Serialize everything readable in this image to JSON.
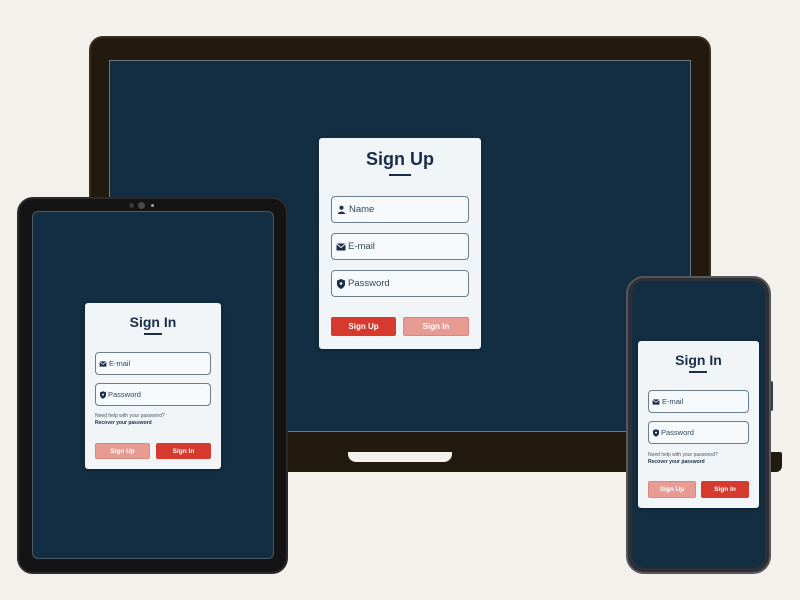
{
  "colors": {
    "page_bg": "#f4f1ec",
    "screen_bg": "#132e42",
    "card_bg": "#f1f5f8",
    "title": "#1b2d4a",
    "primary_red": "#d63a2f",
    "faded_red": "#e89b93",
    "laptop_frame": "#221a0f",
    "tablet_frame": "#141414",
    "phone_frame": "#2e3035"
  },
  "laptop": {
    "title": "Sign Up",
    "fields": {
      "name": {
        "placeholder": "Name",
        "icon": "user-icon"
      },
      "email": {
        "placeholder": "E-mail",
        "icon": "mail-icon"
      },
      "password": {
        "placeholder": "Password",
        "icon": "shield-icon"
      }
    },
    "buttons": {
      "sign_up": "Sign Up",
      "sign_in": "Sign In"
    }
  },
  "tablet": {
    "title": "Sign In",
    "fields": {
      "email": {
        "placeholder": "E-mail",
        "icon": "mail-icon"
      },
      "password": {
        "placeholder": "Password",
        "icon": "shield-icon"
      }
    },
    "help_text": "Need help with your password?",
    "recover_link": "Recover your password",
    "buttons": {
      "sign_up": "Sign Up",
      "sign_in": "Sign In"
    }
  },
  "phone": {
    "title": "Sign In",
    "fields": {
      "email": {
        "placeholder": "E-mail",
        "icon": "mail-icon"
      },
      "password": {
        "placeholder": "Password",
        "icon": "shield-icon"
      }
    },
    "help_text": "Need help with your password?",
    "recover_link": "Recover your password",
    "buttons": {
      "sign_up": "Sign Up",
      "sign_in": "Sign In"
    }
  }
}
